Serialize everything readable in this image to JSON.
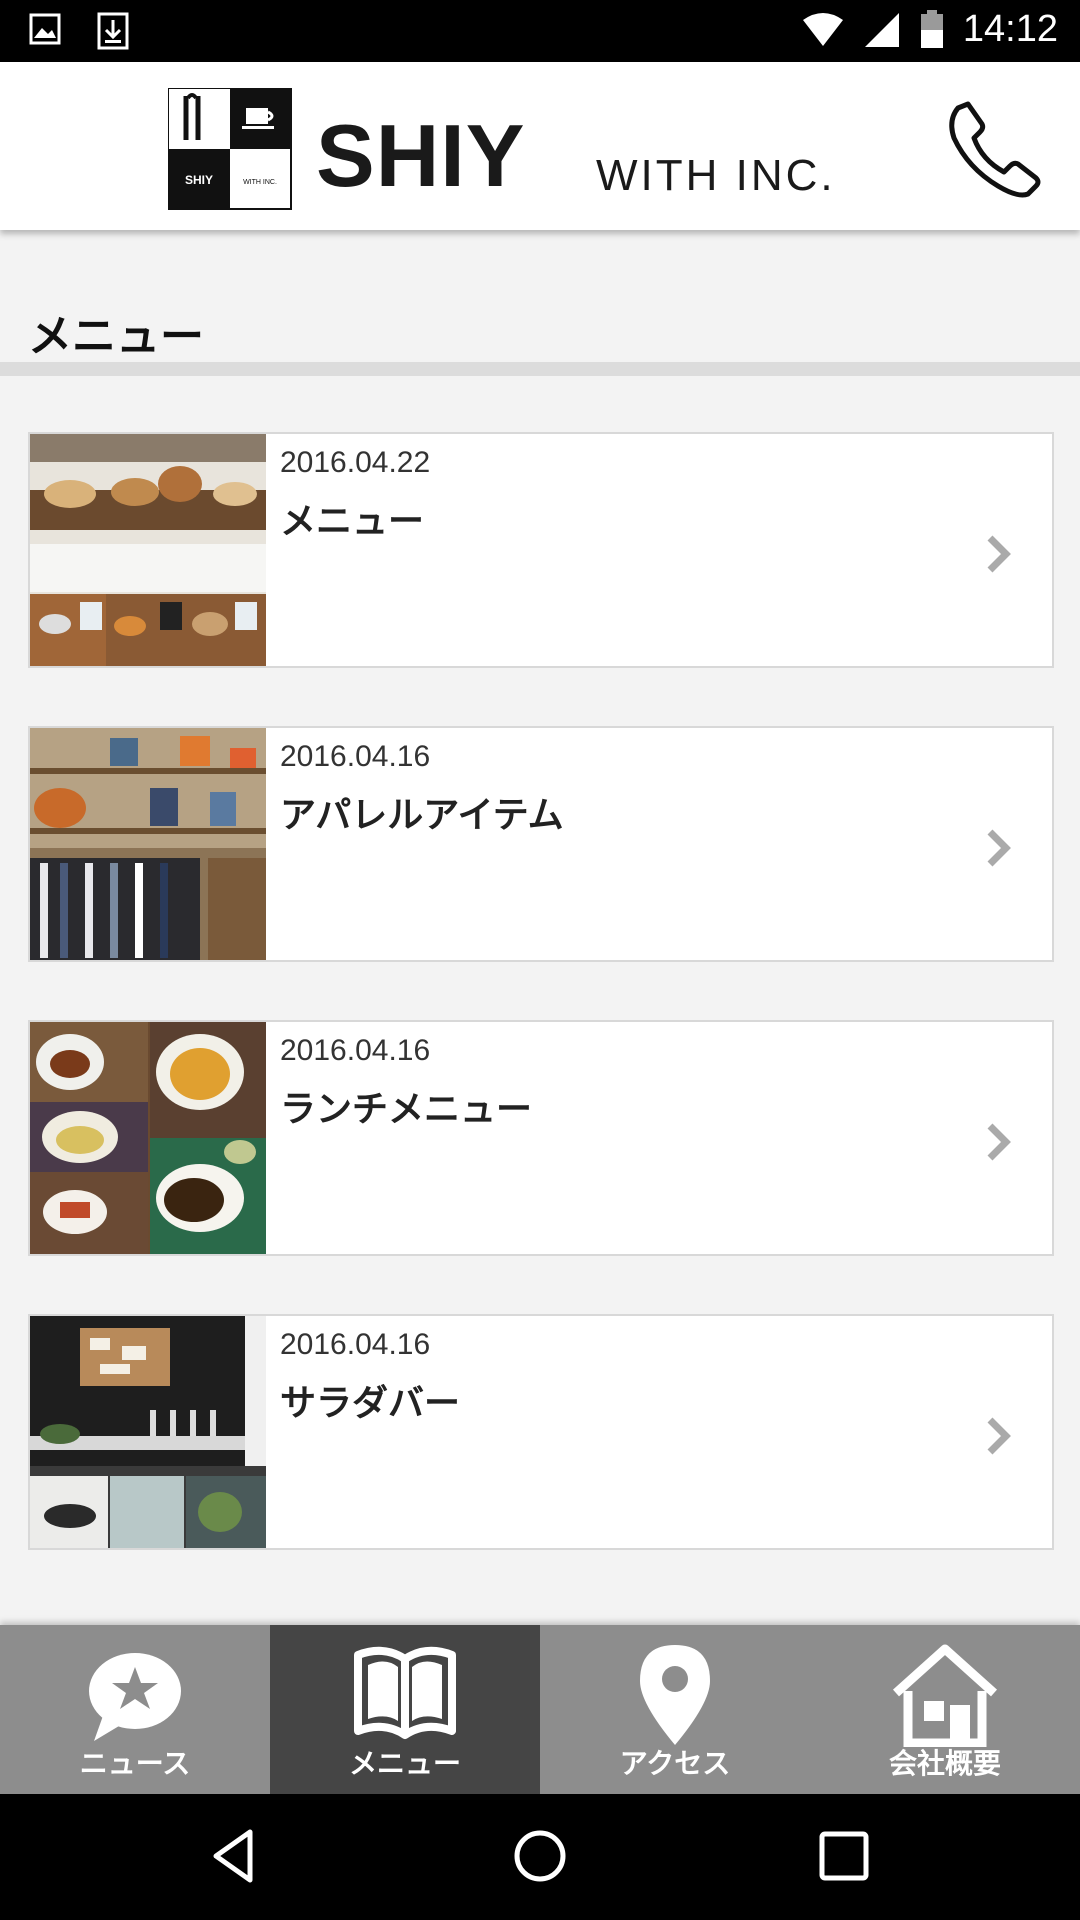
{
  "status_bar": {
    "time": "14:12"
  },
  "header": {
    "logo_title": "SHIY",
    "logo_subtitle": "WITH INC.",
    "logo_box_text_left": "SHIY",
    "logo_box_text_right": "WITH INC."
  },
  "section": {
    "title": "メニュー"
  },
  "items": [
    {
      "date": "2016.04.22",
      "title": "メニュー"
    },
    {
      "date": "2016.04.16",
      "title": "アパレルアイテム"
    },
    {
      "date": "2016.04.16",
      "title": "ランチメニュー"
    },
    {
      "date": "2016.04.16",
      "title": "サラダバー"
    }
  ],
  "tabs": [
    {
      "label": "ニュース",
      "icon": "news-icon"
    },
    {
      "label": "メニュー",
      "icon": "book-icon",
      "active": true
    },
    {
      "label": "アクセス",
      "icon": "map-pin-icon"
    },
    {
      "label": "会社概要",
      "icon": "home-icon"
    }
  ],
  "colors": {
    "tab_bg": "#8d8d8d",
    "tab_active": "#454545",
    "header_bg": "#ffffff"
  }
}
